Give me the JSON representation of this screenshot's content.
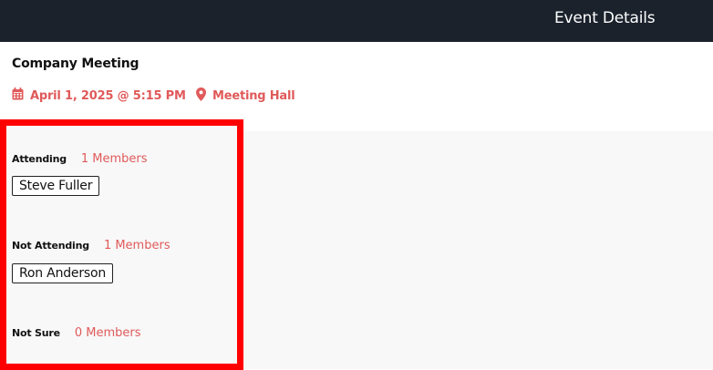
{
  "header": {
    "title": "Event Details"
  },
  "event": {
    "title": "Company Meeting",
    "datetime": "April 1, 2025 @ 5:15 PM",
    "location": "Meeting Hall",
    "date_icon": "calendar-icon",
    "location_icon": "map-pin-icon"
  },
  "colors": {
    "header_bg": "#1b222c",
    "accent": "#e05a5a",
    "highlight_border": "#ff0000"
  },
  "rsvp": {
    "groups": [
      {
        "label": "Attending",
        "count": "1 Members",
        "members": [
          "Steve Fuller"
        ]
      },
      {
        "label": "Not Attending",
        "count": "1 Members",
        "members": [
          "Ron Anderson"
        ]
      },
      {
        "label": "Not Sure",
        "count": "0 Members",
        "members": []
      }
    ]
  }
}
